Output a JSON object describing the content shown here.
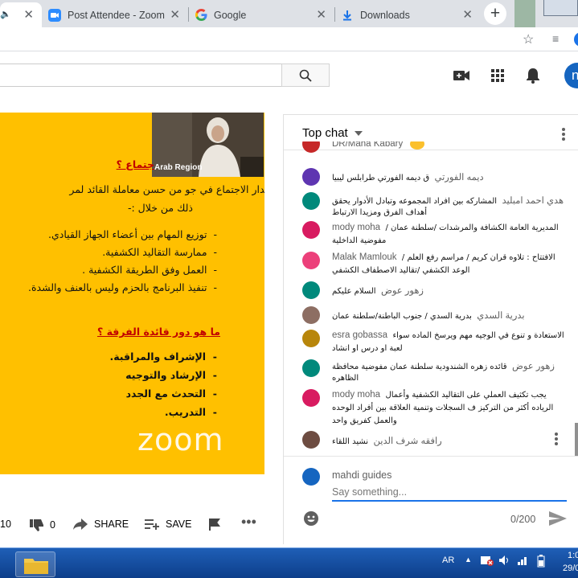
{
  "browser": {
    "tabs": [
      {
        "title": "",
        "active": true
      },
      {
        "title": "Post Attendee - Zoom",
        "active": false
      },
      {
        "title": "Google",
        "active": false
      },
      {
        "title": "Downloads",
        "active": false
      }
    ]
  },
  "video": {
    "speaker_label": "Arab Region",
    "slide": {
      "heading1": "جتماع ؟",
      "intro_line1": "يدار الاجتماع في جو من حسن معاملة القائد لمر",
      "intro_line2": "ذلك من خلال :-",
      "bullets1": [
        "توزيع المهام بين أعضاء الجهاز القيادي.",
        "ممارسة التقاليد الكشفية.",
        "العمل وفق الطريقة الكشفية .",
        "تنفيذ البرنامج بالحزم وليس بالعنف والشدة."
      ],
      "heading2": "ما هو دور قائدة الفرقة ؟",
      "bullets2": [
        "الإشراف والمراقبة.",
        "الإرشاد والتوجيه",
        "التحدث مع الجدد",
        "التدريب."
      ]
    },
    "watermark": "zoom"
  },
  "actions": {
    "like_count": "10",
    "dislike_count": "0",
    "share_label": "SHARE",
    "save_label": "SAVE"
  },
  "chat": {
    "title": "Top chat",
    "messages": [
      {
        "author": "DR/Maha Kabary",
        "lines": [
          ""
        ],
        "avatar_color": "#c62828"
      },
      {
        "author": "ديمه الفورتي",
        "lines": [
          "ق ديمه الفورتي طرابلس ليبيا"
        ],
        "avatar_color": "#5e35b1"
      },
      {
        "author": "هدي احمد امبليد",
        "lines": [
          "المشاركه بين افراد المجموعه وتبادل الأدوار يحقق",
          "أهداف الفرق ومزيدا الارتباط"
        ],
        "avatar_color": "#00897b"
      },
      {
        "author": "mody moha",
        "lines": [
          "المديرية العامة الكشافة والمرشدات /سلطنة عمان /",
          "مفوضية الداخلية"
        ],
        "avatar_color": "#d81b60"
      },
      {
        "author": "Malak Mamlouk",
        "lines": [
          "الافتتاح : تلاوه قران كريم / مراسم رفع العلم /",
          "الوعد الكشفي /تقاليد الاصطفاف الكشفي"
        ],
        "avatar_color": "#ec407a"
      },
      {
        "author": "زهور عوض",
        "lines": [
          "السلام عليكم"
        ],
        "avatar_color": "#00897b"
      },
      {
        "author": "بدرية السدي",
        "lines": [
          "بدرية السدي / جنوب الباطنة/سلطنة عمان"
        ],
        "avatar_color": "#8d6e63"
      },
      {
        "author": "esra gobassa",
        "lines": [
          "الاستعادة و تنوع في الوجيه مهم ويرسخ الماده سواء",
          "لعبة او درس او انشاد"
        ],
        "avatar_color": "#b8860b"
      },
      {
        "author": "زهور عوض",
        "lines": [
          "قائده زهره الشندودية سلطنة عمان مفوضية محافظة",
          "الظاهره"
        ],
        "avatar_color": "#00897b"
      },
      {
        "author": "mody moha",
        "lines": [
          "يجب تكثيف العملي على التقاليد الكشفية وأعمال",
          "الرياده أكثر من التركيز ف السجلات وتنمية العلاقة بين أفراد الوحده",
          "والعمل كفريق واحد"
        ],
        "avatar_color": "#d81b60"
      },
      {
        "author": "رافقه شرف الدين",
        "lines": [
          "نشيد اللقاء"
        ],
        "avatar_color": "#6d4c41"
      }
    ],
    "composer": {
      "user": "mahdi guides",
      "placeholder": "Say something...",
      "counter": "0/200"
    }
  },
  "taskbar": {
    "lang": "AR",
    "time": "1:0",
    "date": "29/0"
  }
}
